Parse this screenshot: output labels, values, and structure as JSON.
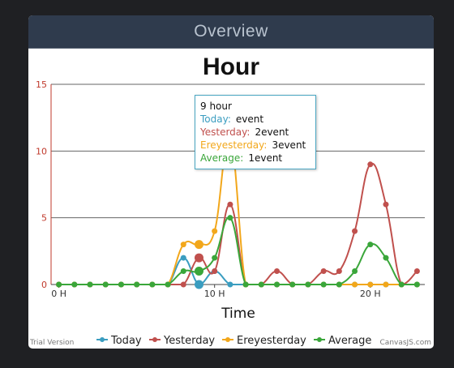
{
  "panel": {
    "title": "Overview"
  },
  "chart_data": {
    "type": "line",
    "title": "Hour",
    "xlabel": "Time",
    "ylabel": "",
    "xlim": [
      -0.5,
      23.5
    ],
    "ylim": [
      0,
      15
    ],
    "x_ticks": [
      {
        "value": 0,
        "label": "0 H"
      },
      {
        "value": 10,
        "label": "10 H"
      },
      {
        "value": 20,
        "label": "20 H"
      }
    ],
    "y_ticks": [
      0,
      5,
      10,
      15
    ],
    "x": [
      0,
      1,
      2,
      3,
      4,
      5,
      6,
      7,
      8,
      9,
      10,
      11,
      12,
      13,
      14,
      15,
      16,
      17,
      18,
      19,
      20,
      21,
      22,
      23
    ],
    "series": [
      {
        "name": "Today",
        "color": "#3a9dc0",
        "values": [
          0,
          0,
          0,
          0,
          0,
          0,
          0,
          0,
          2,
          0,
          1,
          0,
          0,
          0,
          0,
          0,
          0,
          0,
          0,
          0,
          0,
          0,
          0,
          0
        ]
      },
      {
        "name": "Yesterday",
        "color": "#c0504d",
        "values": [
          0,
          0,
          0,
          0,
          0,
          0,
          0,
          0,
          0,
          2,
          1,
          6,
          0,
          0,
          1,
          0,
          0,
          1,
          1,
          4,
          9,
          6,
          0,
          1
        ]
      },
      {
        "name": "Ereyesterday",
        "color": "#f2a71b",
        "values": [
          0,
          0,
          0,
          0,
          0,
          0,
          0,
          0,
          3,
          3,
          4,
          11,
          0,
          0,
          0,
          0,
          0,
          0,
          0,
          0,
          0,
          0,
          0,
          0
        ]
      },
      {
        "name": "Average",
        "color": "#3aa63a",
        "values": [
          0,
          0,
          0,
          0,
          0,
          0,
          0,
          0,
          1,
          1,
          2,
          5,
          0,
          0,
          0,
          0,
          0,
          0,
          0,
          1,
          3,
          2,
          0,
          0
        ]
      }
    ],
    "highlight_x": 9,
    "legend_position": "bottom",
    "grid": true
  },
  "tooltip": {
    "header": "9 hour",
    "rows": [
      {
        "label": "Today:",
        "value": "event",
        "color": "#3a9dc0"
      },
      {
        "label": "Yesterday:",
        "value": "2event",
        "color": "#c0504d"
      },
      {
        "label": "Ereyesterday:",
        "value": "3event",
        "color": "#f2a71b"
      },
      {
        "label": "Average:",
        "value": "1event",
        "color": "#3aa63a"
      }
    ]
  },
  "footer": {
    "trial_text": "Trial Version",
    "credit_text": "CanvasJS.com"
  }
}
